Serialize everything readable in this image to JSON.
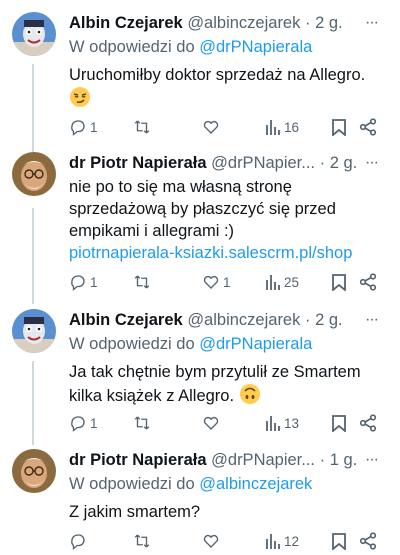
{
  "tweets": [
    {
      "name": "Albin Czejarek",
      "handle": "@albinczejarek",
      "time": "2 g.",
      "reply_prefix": "W odpowiedzi do",
      "reply_to": "@drPNapierala",
      "text": "Uruchomiłby doktor sprzedaż na Allegro.",
      "emoji": "smirk",
      "stats": {
        "replies": "1",
        "reposts": "",
        "likes": "",
        "views": "16"
      }
    },
    {
      "name": "dr Piotr Napierała",
      "handle": "@drPNapier...",
      "time": "2 g.",
      "text": "nie po to się ma własną stronę sprzedażową by płaszczyć się przed empikami i allegrami :)",
      "url": "piotrnapierala-ksiazki.salescrm.pl/shop",
      "stats": {
        "replies": "1",
        "reposts": "",
        "likes": "1",
        "views": "25"
      }
    },
    {
      "name": "Albin Czejarek",
      "handle": "@albinczejarek",
      "time": "2 g.",
      "reply_prefix": "W odpowiedzi do",
      "reply_to": "@drPNapierala",
      "text_line1": "Ja tak chętnie bym przytulił ze Smartem",
      "text_line2": "kilka książek z Allegro.",
      "emoji": "upside-down",
      "stats": {
        "replies": "1",
        "reposts": "",
        "likes": "",
        "views": "13"
      }
    },
    {
      "name": "dr Piotr Napierała",
      "handle": "@drPNapier...",
      "time": "1 g.",
      "reply_prefix": "W odpowiedzi do",
      "reply_to": "@albinczejarek",
      "text": "Z jakim smartem?",
      "stats": {
        "replies": "",
        "reposts": "",
        "likes": "",
        "views": "12"
      }
    }
  ],
  "separator": "·",
  "more_glyph": "···",
  "colors": {
    "accent": "#1d9bf0",
    "muted": "#536471",
    "text": "#0f1419",
    "line": "#cfd9de",
    "emoji": "#ffcc4d"
  }
}
